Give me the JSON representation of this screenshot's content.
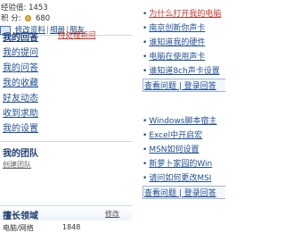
{
  "stats": {
    "experience_label": "经验值:",
    "experience_value": "1453",
    "points_label": "积  分:",
    "points_value": "680"
  },
  "account_links": {
    "profile": "修改资料",
    "album": "相册",
    "friends": "朋友"
  },
  "nav": {
    "items": [
      {
        "label": "我的回答"
      },
      {
        "label": "我的提问"
      },
      {
        "label": "我的问答"
      },
      {
        "label": "我的收藏"
      },
      {
        "label": "好友动态"
      },
      {
        "label": "收到求助"
      },
      {
        "label": "我的设置"
      }
    ],
    "badge": "待处理新问"
  },
  "team": {
    "title": "我的团队",
    "subtitle": "创建团队"
  },
  "ranking": {
    "title": "擅长领域",
    "more": "修改",
    "row": {
      "name": "电脑/网络",
      "value": "1848"
    }
  },
  "right_list": [
    {
      "text": "为什么打开我的电脑",
      "style": "red"
    },
    {
      "text": "南京创新你声卡"
    },
    {
      "text": "谁知道我的硬件"
    },
    {
      "text": "电脑在使用声卡"
    },
    {
      "text": "谁知道8ch声卡设置"
    },
    {
      "text": "查看问题 | 登录回答",
      "style": "boxed"
    },
    {
      "text": "Windows脚本宿主"
    },
    {
      "text": "Excel中开启宏"
    },
    {
      "text": "MSN如何设置"
    },
    {
      "text": "新萝卜家园的Win"
    },
    {
      "text": "请问如何更改MSI"
    },
    {
      "text": "查看问题 | 登录回答",
      "style": "boxed"
    }
  ]
}
